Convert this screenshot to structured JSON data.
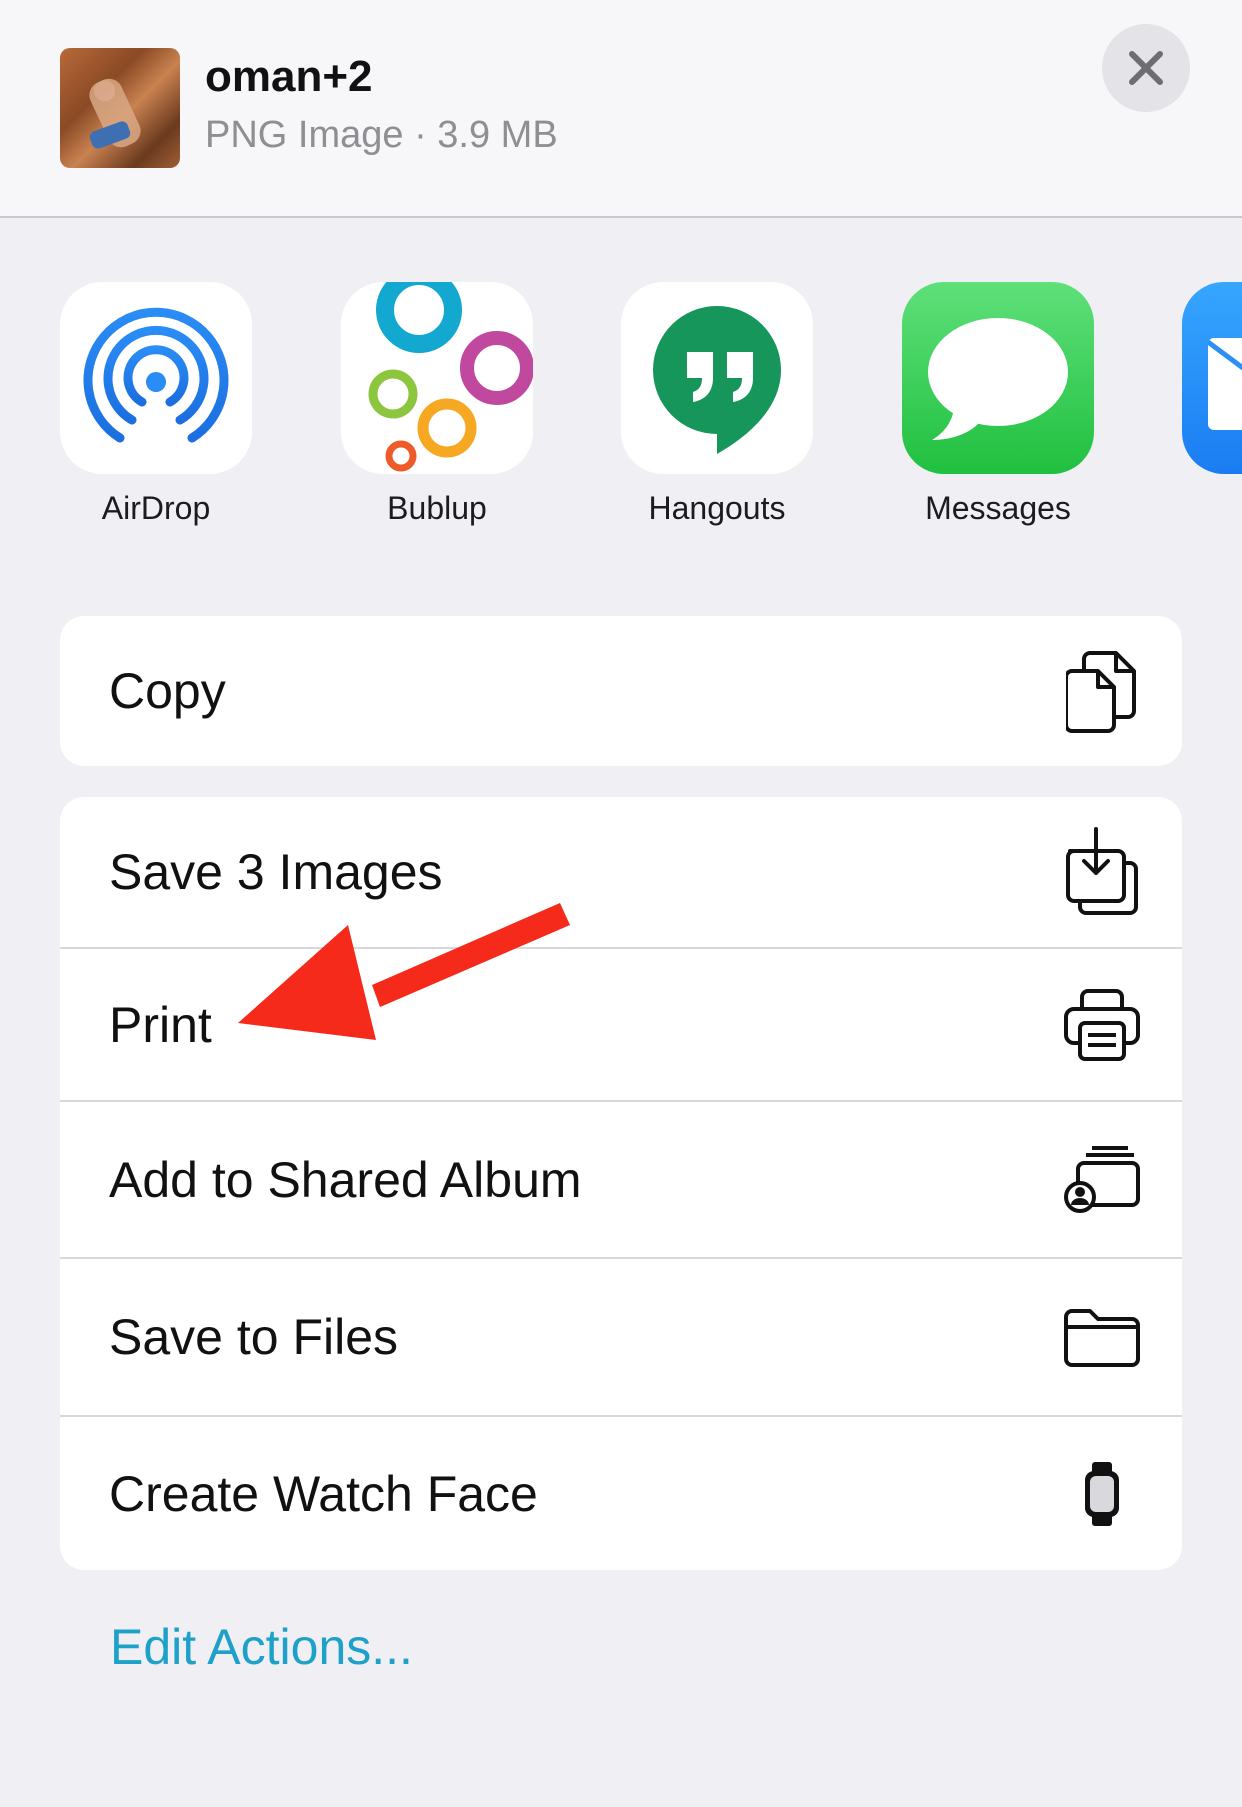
{
  "header": {
    "file_name": "oman+2",
    "file_info": "PNG Image · 3.9 MB"
  },
  "apps": [
    {
      "label": "AirDrop",
      "icon": "airdrop-icon"
    },
    {
      "label": "Bublup",
      "icon": "bublup-icon"
    },
    {
      "label": "Hangouts",
      "icon": "hangouts-icon"
    },
    {
      "label": "Messages",
      "icon": "messages-icon"
    },
    {
      "label": "",
      "icon": "mail-icon"
    }
  ],
  "actions_group1": [
    {
      "label": "Copy",
      "icon": "copy-icon"
    }
  ],
  "actions_group2": [
    {
      "label": "Save 3 Images",
      "icon": "save-image-icon"
    },
    {
      "label": "Print",
      "icon": "printer-icon"
    },
    {
      "label": "Add to Shared Album",
      "icon": "shared-album-icon"
    },
    {
      "label": "Save to Files",
      "icon": "folder-icon"
    },
    {
      "label": "Create Watch Face",
      "icon": "watch-icon"
    }
  ],
  "edit_actions": "Edit Actions...",
  "colors": {
    "background": "#efeff4",
    "accent": "#1da1c9",
    "annotation_arrow": "#f52a1a",
    "messages_green": "#34c759",
    "hangouts_green": "#16965a"
  }
}
